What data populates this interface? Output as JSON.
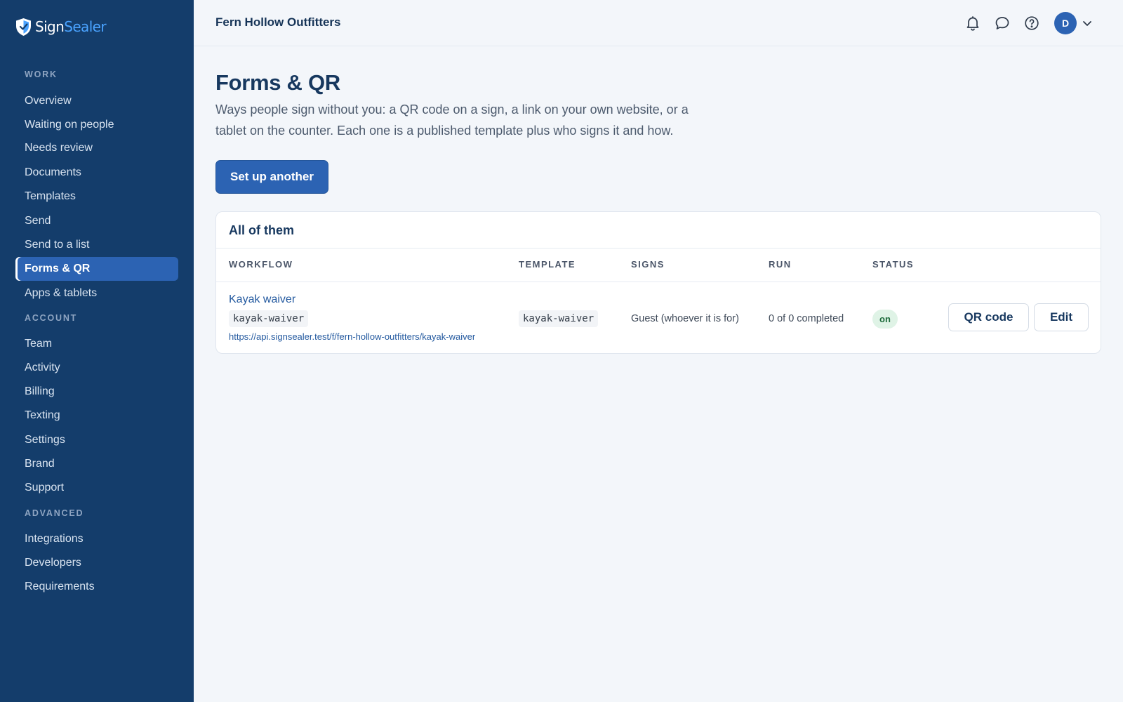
{
  "brand": {
    "name_part1": "Sign",
    "name_part2": "Sealer",
    "colors": {
      "sidebar": "#143d6b",
      "accent": "#2c63b3",
      "logo_accent": "#4aa3ff",
      "status_on_bg": "#dff3e6"
    }
  },
  "sidebar": {
    "sections": [
      {
        "label": "WORK",
        "items": [
          "Overview",
          "Waiting on people",
          "Needs review",
          "Documents",
          "Templates",
          "Send",
          "Send to a list",
          "Forms & QR",
          "Apps & tablets"
        ]
      },
      {
        "label": "ACCOUNT",
        "items": [
          "Team",
          "Activity",
          "Billing",
          "Texting",
          "Settings",
          "Brand",
          "Support"
        ]
      },
      {
        "label": "ADVANCED",
        "items": [
          "Integrations",
          "Developers",
          "Requirements"
        ]
      }
    ],
    "active_item": "Forms & QR"
  },
  "topbar": {
    "org_name": "Fern Hollow Outfitters",
    "icons": [
      "bell-icon",
      "chat-icon",
      "help-icon"
    ],
    "avatar_initial": "D"
  },
  "main": {
    "title": "Forms & QR",
    "description": "Ways people sign without you: a QR code on a sign, a link on your own website, or a tablet on the counter. Each one is a published template plus who signs it and how.",
    "primary_button": "Set up another",
    "card": {
      "title": "All of them",
      "columns": [
        "WORKFLOW",
        "TEMPLATE",
        "SIGNS",
        "RUN",
        "STATUS"
      ],
      "rows": [
        {
          "workflow_name": "Kayak waiver",
          "workflow_slug": "kayak-waiver",
          "workflow_url": "https://api.signsealer.test/f/fern-hollow-outfitters/kayak-waiver",
          "template": "kayak-waiver",
          "signs": "Guest (whoever it is for)",
          "run": "0 of 0 completed",
          "status": "on",
          "actions": [
            "QR code",
            "Edit"
          ]
        }
      ]
    }
  }
}
